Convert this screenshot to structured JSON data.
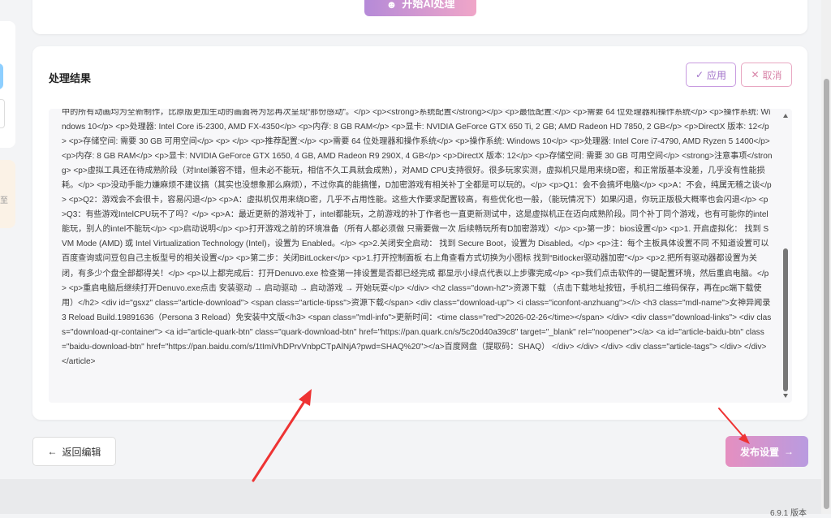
{
  "top": {
    "ai_button_label": "开始AI处理"
  },
  "sidebar": {
    "stray_text": "至"
  },
  "result": {
    "title": "处理结果",
    "apply_label": "应用",
    "cancel_label": "取消",
    "code_lines": "中的所有动画均为全新制作，比原版更加生动的画面将为您再次呈现“那份感动”。</p> <p><strong>系统配置</strong></p> <p>最低配置:</p> <p>需要 64 位处理器和操作系统</p> <p>操作系统: Windows 10</p> <p>处理器: Intel Core i5-2300, AMD FX-4350</p> <p>内存: 8 GB RAM</p> <p>显卡: NVIDIA GeForce GTX 650 Ti, 2 GB; AMD Radeon HD 7850, 2 GB</p> <p>DirectX 版本: 12</p> <p>存储空间: 需要 30 GB 可用空间</p> <p> </p> <p>推荐配置:</p> <p>需要 64 位处理器和操作系统</p> <p>操作系统: Windows 10</p> <p>处理器: Intel Core i7-4790, AMD Ryzen 5 1400</p> <p>内存: 8 GB RAM</p> <p>显卡: NVIDIA GeForce GTX 1650, 4 GB, AMD Radeon R9 290X, 4 GB</p> <p>DirectX 版本: 12</p> <p>存储空间: 需要 30 GB 可用空间</p> <strong>注意事项</strong> <p>虚拟工具还在待成熟阶段（对Intel兼容不错，但未必不能玩，相信不久工具就会成熟），对AMD CPU支持很好。很多玩家实测，虚拟机只是用来绕D密，和正常版基本没差，几乎没有性能损耗。</p> <p>没动手能力嫌麻烦不建议搞（其实也没想象那么麻烦），不过你真的能搞懂，D加密游戏有相关补丁全都是可以玩的。</p> <p>Q1：会不会搞坏电脑</p> <p>A：不会，纯属无稽之谈</p> <p>Q2：游戏会不会很卡，容易闪退</p> <p>A：虚拟机仅用来绕D密，几乎不占用性能。这些大作要求配置较高，有些优化也一般，（能玩情况下）如果闪退，你玩正版极大概率也会闪退</p> <p>Q3：有些游戏IntelCPU玩不了吗？</p> <p>A：最近更新的游戏补丁，intel都能玩，之前游戏的补丁作者也一直更新测试中，这是虚拟机正在迈向成熟阶段。同个补丁同个游戏，也有可能你的intel能玩，别人的intel不能玩</p> <p>启动说明</p> <p>打开游戏之前的环境准备（所有人都必须做 只需要做一次 后续畅玩所有D加密游戏）</p> <p>第一步：bios设置</p> <p>1. 开启虚拟化： 找到 SVM Mode (AMD) 或 Intel Virtualization Technology (Intel)，设置为 Enabled。</p> <p>2.关闭安全启动： 找到 Secure Boot，设置为 Disabled。</p> <p>注：每个主板具体设置不同 不知道设置可以百度查询或问豆包自己主板型号的相关设置</p> <p>第二步：关闭BitLocker</p> <p>1.打开控制面板 右上角查看方式切换为小图标 找到“Bitlocker驱动器加密”</p> <p>2.把所有驱动器都设置为关闭，有多少个盘全部都得关！</p> <p>以上都完成后：打开Denuvo.exe 检查第一排设置是否都已经完成 都显示小绿点代表以上步骤完成</p> <p>我们点击软件的一键配置环境，然后重启电脑。</p> <p>重启电脑后继续打开Denuvo.exe点击 安装驱动 → 启动驱动 → 启动游戏 → 开始玩耍</p> </div> <h2 class=\"down-h2\">资源下载 （点击下载地址按钮，手机扫二维码保存，再在pc端下载使用）</h2> <div id=\"gsxz\" class=\"article-download\"> <span class=\"article-tipss\">资源下载</span> <div class=\"download-up\"> <i class=\"iconfont-anzhuang\"></i> <h3 class=\"mdl-name\">女神异闻录3 Reload Build.19891636（Persona 3 Reload）免安装中文版</h3> <span class=\"mdl-info\">更新时间：<time class=\"red\">2026-02-26</time></span> </div> <div class=\"download-links\"> <div class=\"download-qr-container\"> <a id=\"article-quark-btn\" class=\"quark-download-btn\" href=\"https://pan.quark.cn/s/5c20d40a39c8\" target=\"_blank\" rel=\"noopener\"></a> <a id=\"article-baidu-btn\" class=\"baidu-download-btn\" href=\"https://pan.baidu.com/s/1tImiVhDPrvVnbpCTpAlNjA?pwd=SHAQ%20\"></a>百度网盘（提取码：SHAQ） </div> </div> </div> <div class=\"article-tags\"> </div> </div> </article>"
  },
  "footer": {
    "back_label": "返回编辑",
    "publish_label": "发布设置",
    "version": "6.9.1 版本"
  },
  "colors": {
    "accent_purple": "#a071c9",
    "accent_pink": "#e58fc0",
    "arrow_red": "#ee3333"
  }
}
